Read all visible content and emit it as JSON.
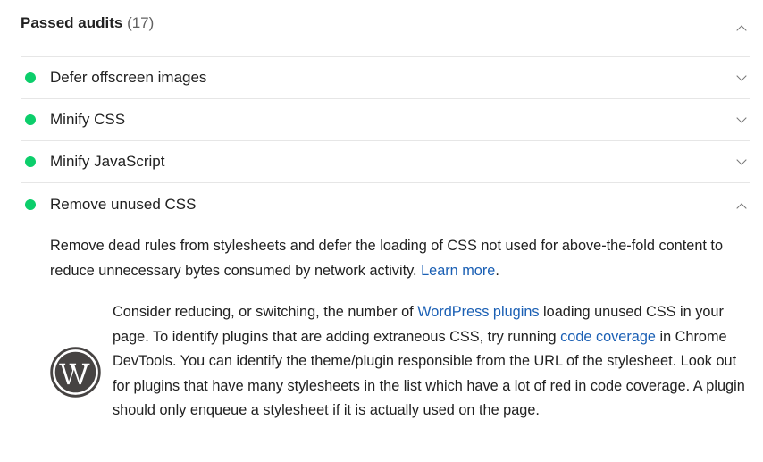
{
  "section": {
    "title": "Passed audits",
    "count": "(17)"
  },
  "audits": [
    {
      "title": "Defer offscreen images",
      "status": "pass",
      "expanded": false
    },
    {
      "title": "Minify CSS",
      "status": "pass",
      "expanded": false
    },
    {
      "title": "Minify JavaScript",
      "status": "pass",
      "expanded": false
    },
    {
      "title": "Remove unused CSS",
      "status": "pass",
      "expanded": true
    }
  ],
  "expanded_audit": {
    "description_text": "Remove dead rules from stylesheets and defer the loading of CSS not used for above-the-fold content to reduce unnecessary bytes consumed by network activity.",
    "learn_more_label": "Learn more",
    "learn_more_suffix": ".",
    "wordpress_note": {
      "text_1": "Consider reducing, or switching, the number of ",
      "link_plugins": "WordPress plugins",
      "text_2": " loading unused CSS in your page. To identify plugins that are adding extraneous CSS, try running ",
      "link_coverage": "code coverage",
      "text_3": " in Chrome DevTools. You can identify the theme/plugin responsible from the URL of the stylesheet. Look out for plugins that have many stylesheets in the list which have a lot of red in code coverage. A plugin should only enqueue a stylesheet if it is actually used on the page."
    }
  },
  "icons": {
    "pass_indicator": "green-circle",
    "collapse": "chevron-up-icon",
    "expand": "chevron-down-icon",
    "logo": "wordpress-logo"
  },
  "colors": {
    "pass_green": "#0cce6b",
    "link_blue": "#1a5fb4",
    "text": "#212121",
    "divider": "#e6e6e6"
  }
}
